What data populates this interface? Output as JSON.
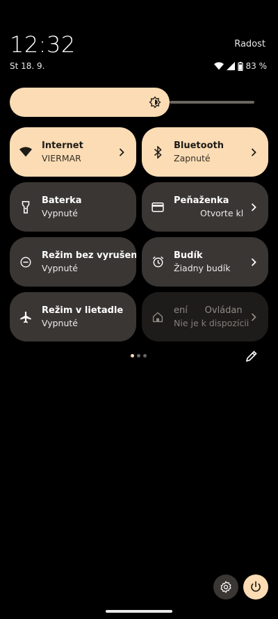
{
  "status": {
    "time": "12:32",
    "date": "St 18. 9.",
    "carrier": "Radost",
    "battery": "83 %"
  },
  "brightness": {
    "level": 0.62
  },
  "tiles": [
    {
      "title": "Internet",
      "subtitle": "VIERMAR",
      "state": "active",
      "icon": "wifi-icon",
      "chevron": true
    },
    {
      "title": "Bluetooth",
      "subtitle": "Zapnuté",
      "state": "active",
      "icon": "bluetooth-icon",
      "chevron": true
    },
    {
      "title": "Baterka",
      "subtitle": "Vypnuté",
      "state": "off",
      "icon": "flashlight-icon",
      "chevron": false
    },
    {
      "title": "Peňaženka",
      "subtitle": "Otvorte kl",
      "state": "off",
      "icon": "wallet-icon",
      "chevron": true
    },
    {
      "title": "Režim bez vyrušení",
      "subtitle": "Vypnuté",
      "state": "off",
      "icon": "do-not-disturb-icon",
      "chevron": false
    },
    {
      "title": "Budík",
      "subtitle": "Žiadny budík",
      "state": "off",
      "icon": "alarm-icon",
      "chevron": true
    },
    {
      "title": "Režim v lietadle",
      "subtitle": "Vypnuté",
      "state": "off",
      "icon": "airplane-icon",
      "chevron": false
    },
    {
      "title": "ení      Ovládan",
      "subtitle": "Nie je k dispozícii",
      "state": "dim",
      "icon": "home-icon",
      "chevron": true
    }
  ],
  "colors": {
    "accent": "#fbdcb4",
    "tile_off": "#3a3633",
    "tile_dim": "#1e1c1a",
    "background": "#000000"
  }
}
